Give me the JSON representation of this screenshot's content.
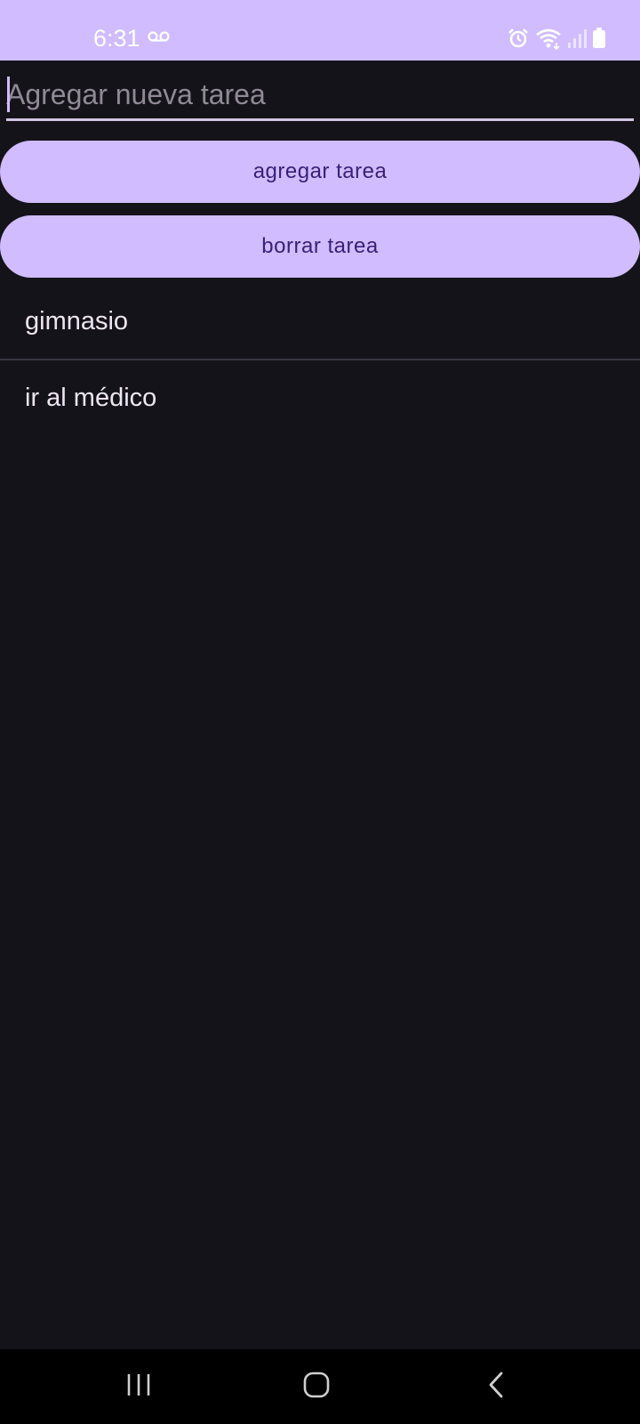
{
  "status_bar": {
    "time": "6:31",
    "icons": [
      "voicemail-icon",
      "alarm-icon",
      "wifi-icon",
      "signal-icon",
      "battery-icon"
    ]
  },
  "input": {
    "placeholder": "Agregar nueva tarea",
    "value": ""
  },
  "buttons": {
    "add_label": "agregar tarea",
    "delete_label": "borrar tarea"
  },
  "tasks": [
    {
      "label": "gimnasio"
    },
    {
      "label": "ir al médico"
    }
  ],
  "navigation": {
    "icons": [
      "recents-icon",
      "home-icon",
      "back-icon"
    ]
  },
  "colors": {
    "accent": "#d0bcff",
    "background": "#15131a",
    "button_text": "#3b1f75"
  }
}
